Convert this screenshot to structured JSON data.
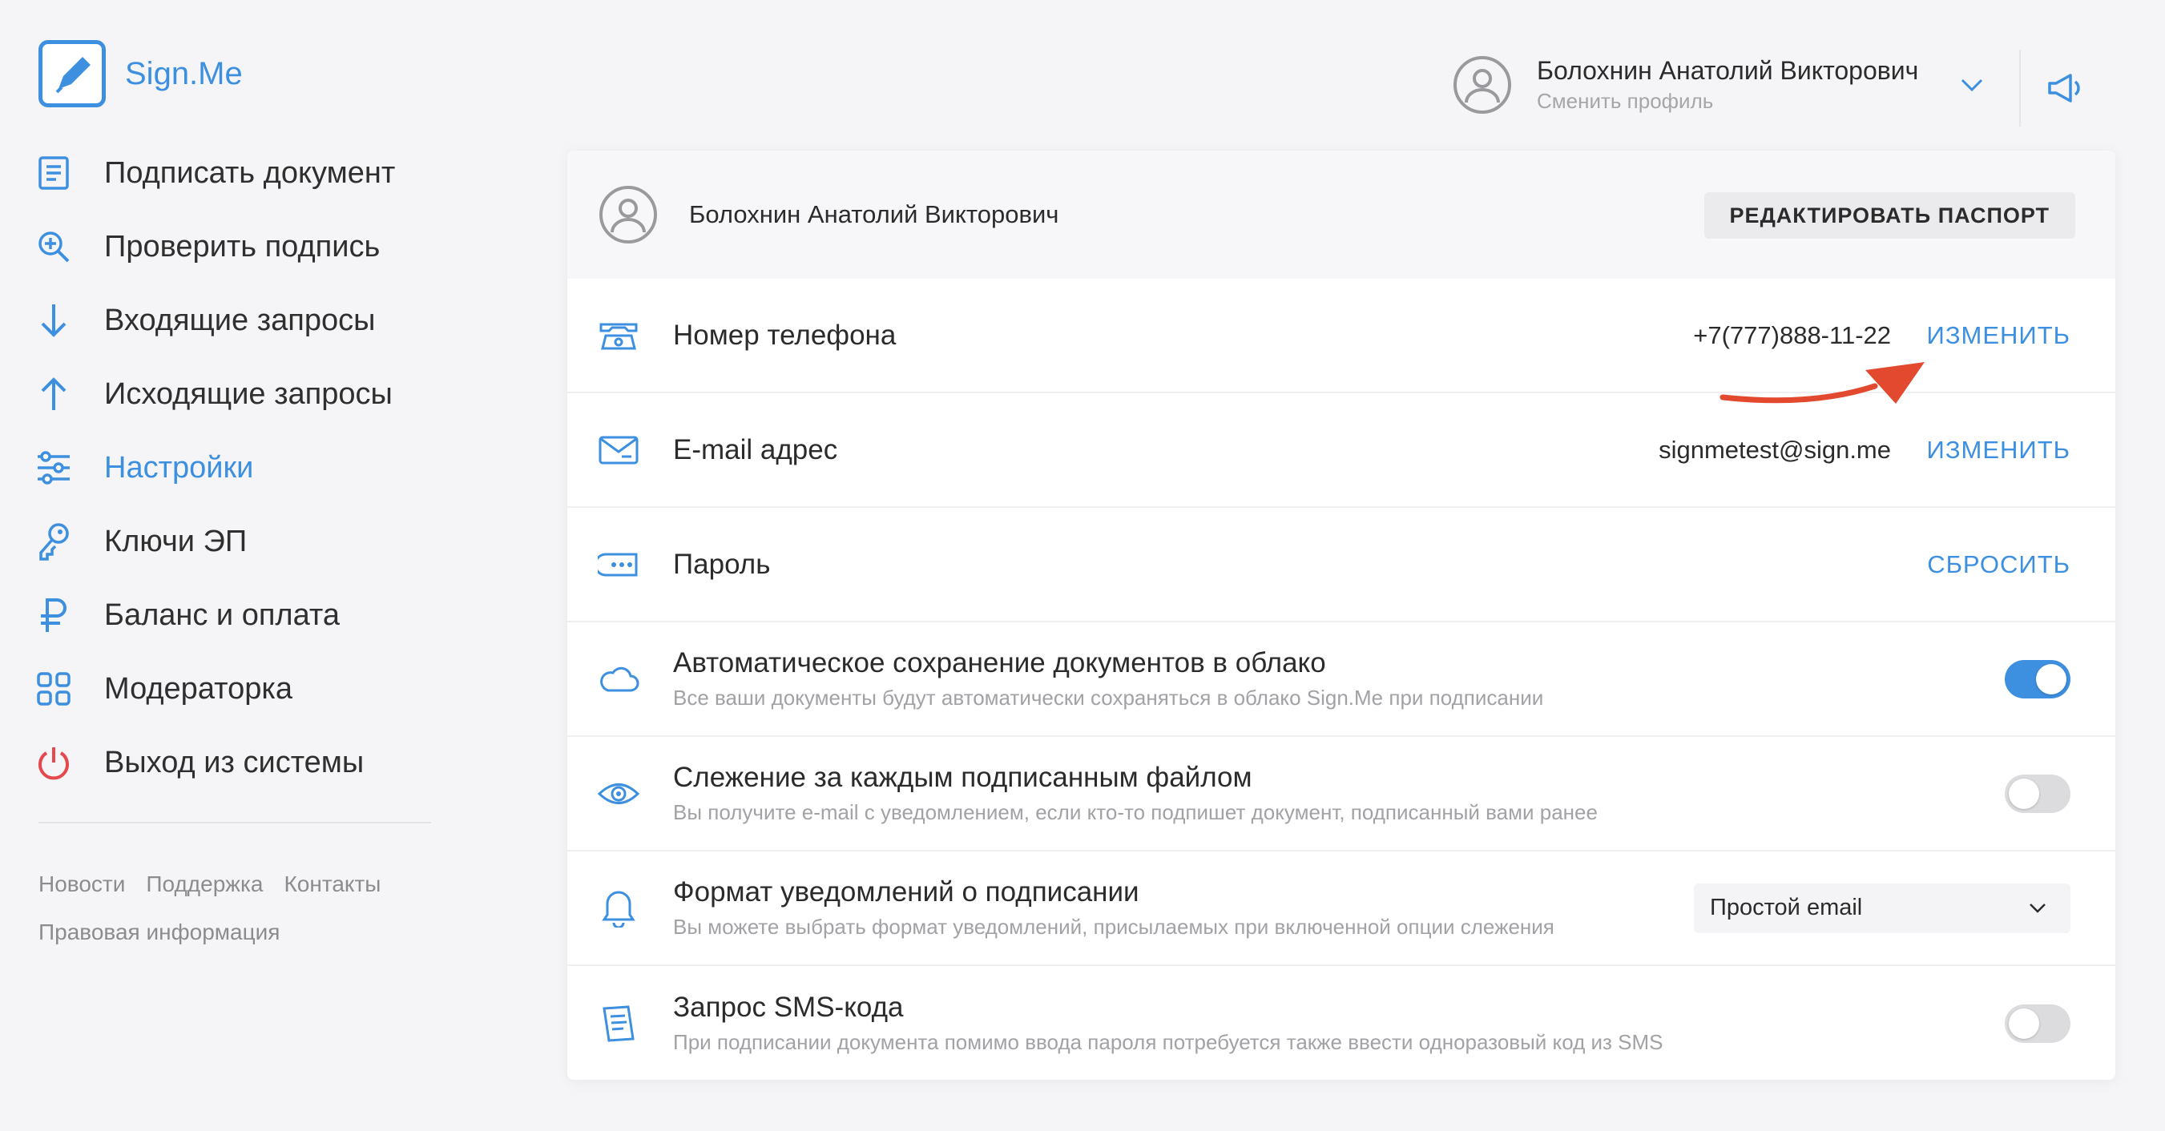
{
  "brand": {
    "name": "Sign.Me",
    "accent": "#3d8fe0"
  },
  "sidebar": {
    "items": [
      {
        "label": "Подписать документ",
        "icon": "document-icon",
        "active": false
      },
      {
        "label": "Проверить подпись",
        "icon": "search-check-icon",
        "active": false
      },
      {
        "label": "Входящие запросы",
        "icon": "arrow-down-icon",
        "active": false
      },
      {
        "label": "Исходящие запросы",
        "icon": "arrow-up-icon",
        "active": false
      },
      {
        "label": "Настройки",
        "icon": "sliders-icon",
        "active": true
      },
      {
        "label": "Ключи ЭП",
        "icon": "key-icon",
        "active": false
      },
      {
        "label": "Баланс и оплата",
        "icon": "ruble-icon",
        "active": false
      },
      {
        "label": "Модераторка",
        "icon": "grid-icon",
        "active": false
      },
      {
        "label": "Выход из системы",
        "icon": "power-icon",
        "active": false
      }
    ],
    "footer_links": [
      "Новости",
      "Поддержка",
      "Контакты",
      "Правовая информация"
    ]
  },
  "header": {
    "user_name": "Болохнин Анатолий Викторович",
    "switch_profile": "Сменить профиль"
  },
  "profile": {
    "name": "Болохнин Анатолий Викторович",
    "edit_passport_label": "РЕДАКТИРОВАТЬ ПАСПОРТ"
  },
  "settings": {
    "phone": {
      "title": "Номер телефона",
      "value": "+7(777)888-11-22",
      "action": "ИЗМЕНИТЬ"
    },
    "email": {
      "title": "E-mail адрес",
      "value": "signmetest@sign.me",
      "action": "ИЗМЕНИТЬ"
    },
    "password": {
      "title": "Пароль",
      "action": "СБРОСИТЬ"
    },
    "autosave": {
      "title": "Автоматическое сохранение документов в облако",
      "subtitle": "Все ваши документы будут автоматически сохраняться в облако Sign.Me при подписании",
      "enabled": true
    },
    "tracking": {
      "title": "Слежение за каждым подписанным файлом",
      "subtitle": "Вы получите e-mail с уведомлением, если кто-то подпишет документ, подписанный вами ранее",
      "enabled": false
    },
    "notify_format": {
      "title": "Формат уведомлений о подписании",
      "subtitle": "Вы можете выбрать формат уведомлений, присылаемых при включенной опции слежения",
      "selected": "Простой email"
    },
    "sms": {
      "title": "Запрос SMS-кода",
      "subtitle": "При подписании документа помимо ввода пароля потребуется также ввести одноразовый код из SMS",
      "enabled": false
    }
  },
  "annotation": {
    "color": "#e2492f"
  }
}
